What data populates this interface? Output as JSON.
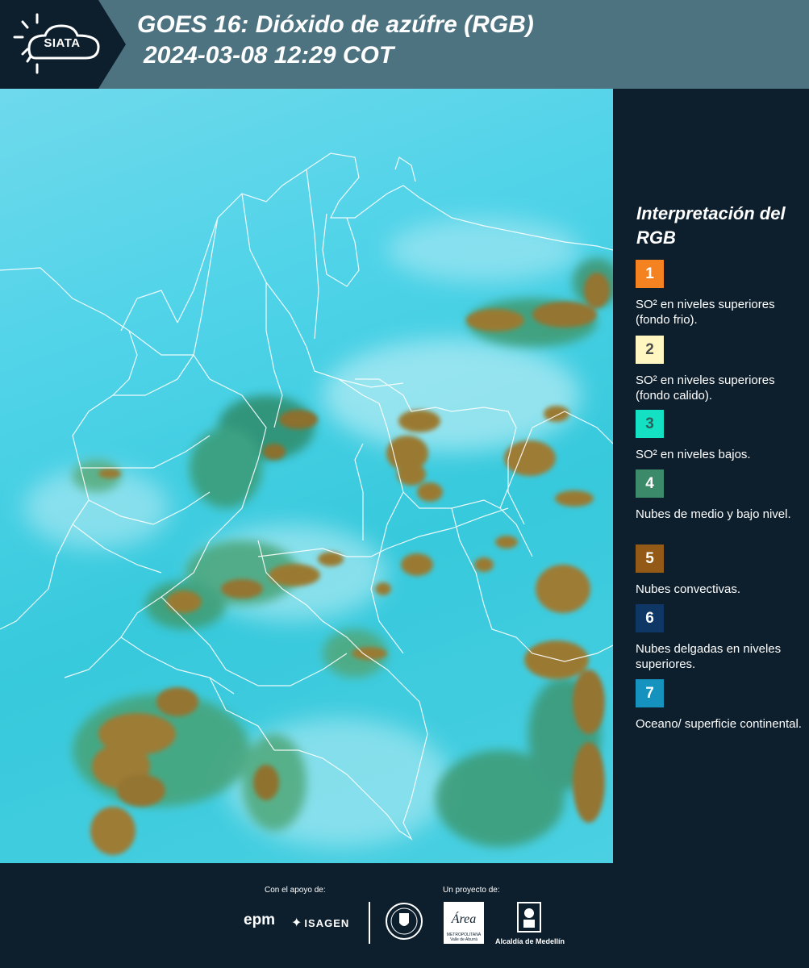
{
  "header": {
    "logo_text": "SIATA",
    "title_line1": "GOES 16: Dióxido de azúfre (RGB)",
    "title_line2": "2024-03-08 12:29 COT"
  },
  "legend": {
    "title": "Interpretación del RGB",
    "items": [
      {
        "number": "1",
        "label": "SO² en niveles superiores (fondo frio).",
        "color": "#f58220",
        "text_color": "#ffffff"
      },
      {
        "number": "2",
        "label": "SO² en niveles superiores (fondo calido).",
        "color": "#fff6c2",
        "text_color": "#4a4a4a"
      },
      {
        "number": "3",
        "label": "SO² en niveles bajos.",
        "color": "#14e0c4",
        "text_color": "#2e5f5a"
      },
      {
        "number": "4",
        "label": "Nubes de medio y bajo nivel.",
        "color": "#3b8b6b",
        "text_color": "#ffffff"
      },
      {
        "number": "5",
        "label": "Nubes convectivas.",
        "color": "#935a17",
        "text_color": "#ffffff"
      },
      {
        "number": "6",
        "label": "Nubes delgadas en niveles superiores.",
        "color": "#0e3765",
        "text_color": "#ffffff"
      },
      {
        "number": "7",
        "label": "Oceano/ superficie continental.",
        "color": "#1592bd",
        "text_color": "#ffffff"
      }
    ]
  },
  "footer": {
    "support_caption": "Con el apoyo de:",
    "project_caption": "Un proyecto de:",
    "epm_logo": "epm",
    "isagen_logo": "ISAGEN",
    "area_logo": "Área",
    "area_subtitle": "METROPOLITANA Valle de Aburrá",
    "alcaldia": "Alcaldía de Medellín"
  },
  "colors": {
    "header_bg": "#4d7381",
    "panel_bg": "#0d1f2d",
    "cloud_convective": "#9a7a33",
    "cloud_mid": "#3f9c74",
    "background_land": "#3fcde0"
  }
}
